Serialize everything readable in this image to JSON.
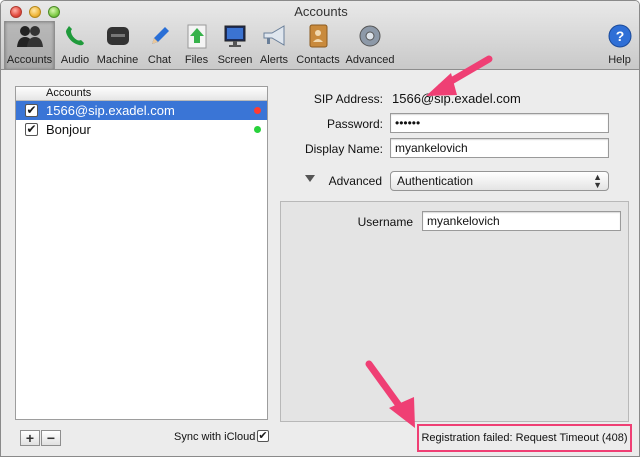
{
  "window": {
    "title": "Accounts"
  },
  "toolbar": {
    "items": [
      {
        "label": "Accounts"
      },
      {
        "label": "Audio"
      },
      {
        "label": "Machine"
      },
      {
        "label": "Chat"
      },
      {
        "label": "Files"
      },
      {
        "label": "Screen"
      },
      {
        "label": "Alerts"
      },
      {
        "label": "Contacts"
      },
      {
        "label": "Advanced"
      }
    ],
    "help": "Help"
  },
  "accounts_list": {
    "header": "Accounts",
    "rows": [
      {
        "name": "1566@sip.exadel.com",
        "checked": "✔",
        "status_color": "#ff3b30"
      },
      {
        "name": "Bonjour",
        "checked": "✔",
        "status_color": "#28d23c"
      }
    ],
    "add_label": "+",
    "remove_label": "−",
    "sync_label": "Sync with iCloud",
    "sync_checked": "✔"
  },
  "form": {
    "sip_label": "SIP Address:",
    "sip_value": "1566@sip.exadel.com",
    "password_label": "Password:",
    "password_value": "••••••",
    "display_label": "Display Name:",
    "display_value": "myankelovich",
    "advanced_label": "Advanced",
    "advanced_popup": "Authentication",
    "username_label": "Username",
    "username_value": "myankelovich"
  },
  "status": {
    "text": "Registration failed: Request Timeout (408)"
  },
  "colors": {
    "accent": "#3a75d6",
    "annotation": "#ef3f74"
  }
}
